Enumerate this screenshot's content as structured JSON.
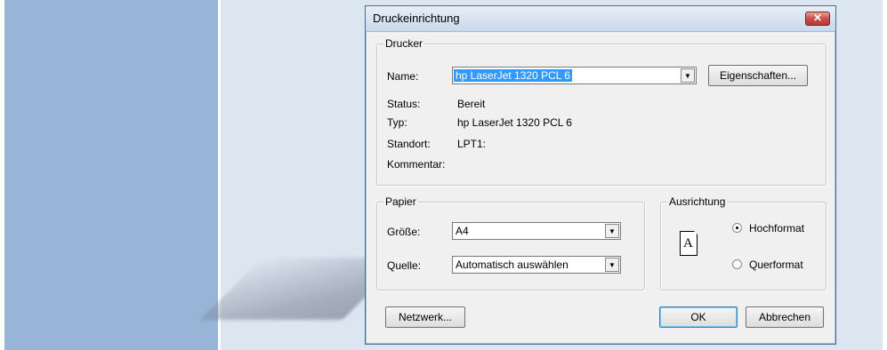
{
  "dialog": {
    "title": "Druckeinrichtung",
    "close_glyph": "✕"
  },
  "printer": {
    "legend": "Drucker",
    "name_label": "Name:",
    "name_value": "hp LaserJet 1320 PCL 6",
    "properties_button": "Eigenschaften...",
    "status_label": "Status:",
    "status_value": "Bereit",
    "type_label": "Typ:",
    "type_value": "hp LaserJet 1320 PCL 6",
    "location_label": "Standort:",
    "location_value": "LPT1:",
    "comment_label": "Kommentar:",
    "comment_value": ""
  },
  "paper": {
    "legend": "Papier",
    "size_label": "Größe:",
    "size_value": "A4",
    "source_label": "Quelle:",
    "source_value": "Automatisch auswählen"
  },
  "orientation": {
    "legend": "Ausrichtung",
    "icon_letter": "A",
    "portrait_label": "Hochformat",
    "landscape_label": "Querformat",
    "selected": "portrait"
  },
  "buttons": {
    "network": "Netzwerk...",
    "ok": "OK",
    "cancel": "Abbrechen"
  }
}
